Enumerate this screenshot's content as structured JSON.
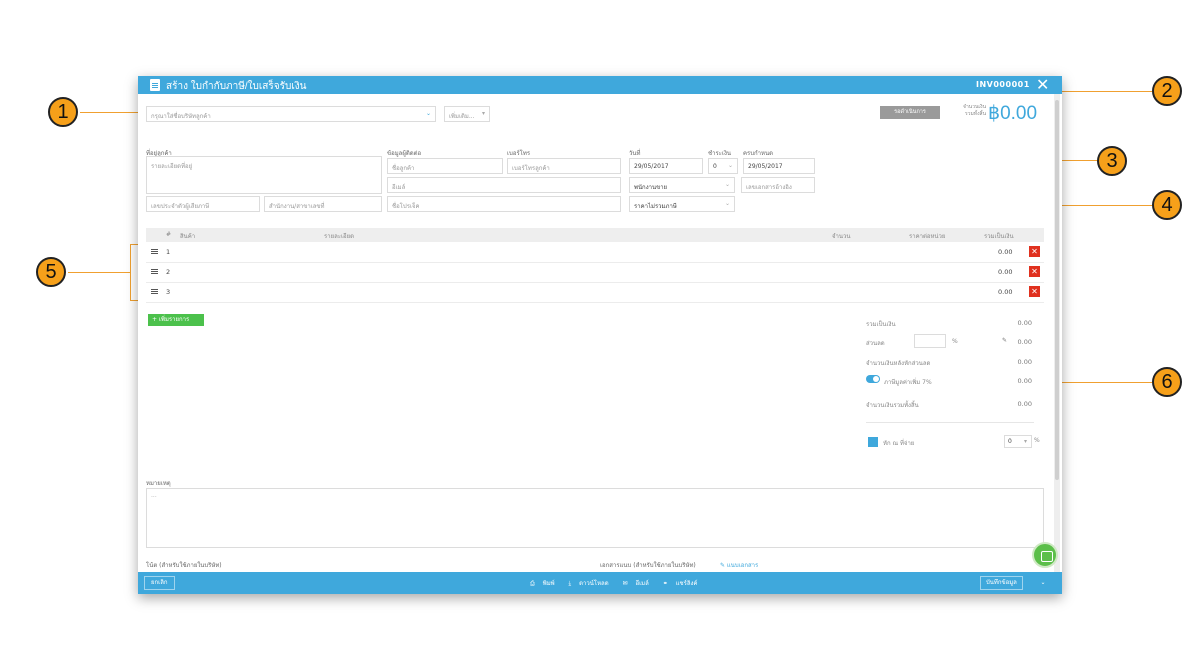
{
  "callouts": [
    "1",
    "2",
    "3",
    "4",
    "5",
    "6"
  ],
  "window": {
    "title": "สร้าง ใบกำกับภาษี/ใบเสร็จรับเงิน",
    "invoice_no": "INV000001",
    "close_glyph": "✕"
  },
  "top": {
    "customer_placeholder": "กรุณาใส่ชื่อบริษัทลูกค้า",
    "more_label": "เพิ่มเติม...",
    "status_label": "รอดำเนินการ",
    "total_label_1": "จำนวนเงิน",
    "total_label_2": "รวมทั้งสิ้น",
    "total_value": "฿0.00"
  },
  "form": {
    "address_label": "ที่อยู่ลูกค้า",
    "address_placeholder": "รายละเอียดที่อยู่",
    "taxid_placeholder": "เลขประจำตัวผู้เสียภาษี",
    "branch_placeholder": "สำนักงาน/สาขาเลขที่",
    "contact_label": "ข้อมูลผู้ติดต่อ",
    "contact_name_placeholder": "ชื่อลูกค้า",
    "email_placeholder": "อีเมล์",
    "project_placeholder": "ชื่อโปรเจ็ค",
    "phone_label": "เบอร์โทร",
    "phone_placeholder": "เบอร์โทรลูกค้า",
    "date_label": "วันที่",
    "date_value": "29/05/2017",
    "credit_label": "ชำระเงิน",
    "credit_value": "0",
    "due_label": "ครบกำหนด",
    "due_value": "29/05/2017",
    "salesperson_value": "พนักงานขาย",
    "ref_placeholder": "เลขเอกสารอ้างอิง",
    "price_type_value": "ราคาไม่รวมภาษี"
  },
  "table": {
    "headers": [
      "#",
      "สินค้า",
      "รายละเอียด",
      "จำนวน",
      "ราคาต่อหน่วย",
      "รวมเป็นเงิน"
    ],
    "rows": [
      {
        "num": "1",
        "amount": "0.00"
      },
      {
        "num": "2",
        "amount": "0.00"
      },
      {
        "num": "3",
        "amount": "0.00"
      }
    ],
    "add_label": "+ เพิ่มรายการ"
  },
  "summary": {
    "subtotal_label": "รวมเป็นเงิน",
    "subtotal_value": "0.00",
    "discount_label": "ส่วนลด",
    "discount_unit": "%",
    "discount_value": "0.00",
    "after_discount_label": "จำนวนเงินหลังหักส่วนลด",
    "after_discount_value": "0.00",
    "vat_label": "ภาษีมูลค่าเพิ่ม 7%",
    "vat_value": "0.00",
    "grand_total_label": "จำนวนเงินรวมทั้งสิ้น",
    "grand_total_value": "0.00",
    "withholding_label": "หัก ณ ที่จ่าย",
    "withholding_value": "0",
    "withholding_unit": "%"
  },
  "notes": {
    "remark_label": "หมายเหตุ",
    "remark_placeholder": "...",
    "internal_note_label": "โน้ต (สำหรับใช้ภายในบริษัท)",
    "attachment_label": "เอกสารแนบ (สำหรับใช้ภายในบริษัท)",
    "attach_link": "✎ แนบเอกสาร"
  },
  "footer": {
    "cancel_label": "ยกเลิก",
    "print_label": "พิมพ์",
    "download_label": "ดาวน์โหลด",
    "email_label": "อีเมล์",
    "share_label": "แชร์ลิงค์",
    "save_label": "บันทึกข้อมูล",
    "save_caret": "⌄"
  },
  "colors": {
    "primary": "#3fa8dc",
    "callout": "#f6a01a",
    "delete": "#e0301e",
    "add": "#4cc14c"
  }
}
